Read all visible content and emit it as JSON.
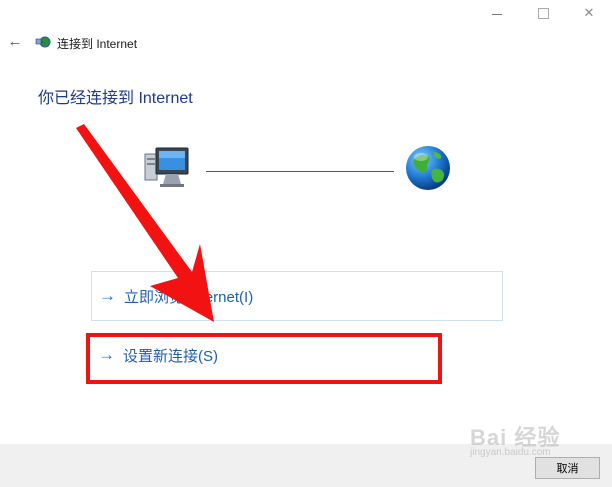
{
  "window": {
    "title": "连接到 Internet",
    "controls": {
      "minimize": "",
      "maximize": "",
      "close": "✕"
    }
  },
  "header": {
    "back_icon": "back-arrow-icon",
    "app_icon": "network-globe-icon"
  },
  "main": {
    "heading": "你已经连接到 Internet",
    "diagram": {
      "left_icon": "computer-icon",
      "right_icon": "globe-icon"
    },
    "options": [
      {
        "label": "立即浏览 Internet(I)",
        "icon": "arrow-right-icon"
      },
      {
        "label": "设置新连接(S)",
        "icon": "arrow-right-icon"
      }
    ]
  },
  "footer": {
    "cancel_label": "取消"
  },
  "watermark": {
    "text": "Bai 经验",
    "subtext": "jingyan.baidu.com"
  },
  "colors": {
    "heading": "#1e3a8a",
    "link": "#1f5fb0",
    "annotation": "#f21212"
  }
}
